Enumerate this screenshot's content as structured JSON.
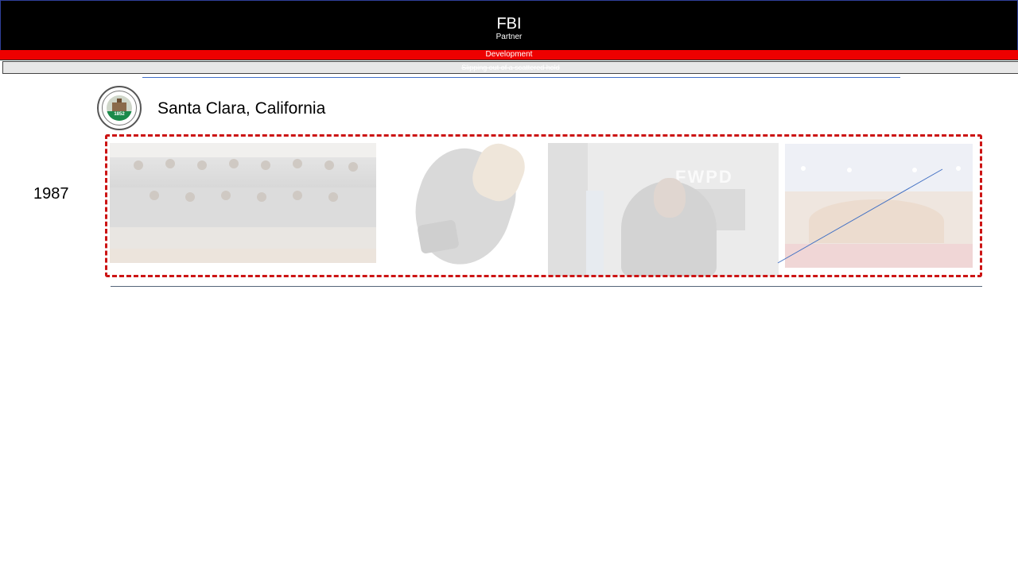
{
  "header": {
    "title": "FBI",
    "subtitle": "Partner"
  },
  "bars": {
    "red_label": "Development",
    "grey_label": "Slipping out of a scattered hold"
  },
  "entry": {
    "city": "Santa Clara, California",
    "year": "1987",
    "seal_year": "1852"
  },
  "photos": {
    "police_sign": "FWPD"
  },
  "colors": {
    "header_bg": "#000000",
    "accent_red": "#ee0000",
    "frame_red": "#cc1414",
    "rule_blue": "#3f6ec6"
  }
}
